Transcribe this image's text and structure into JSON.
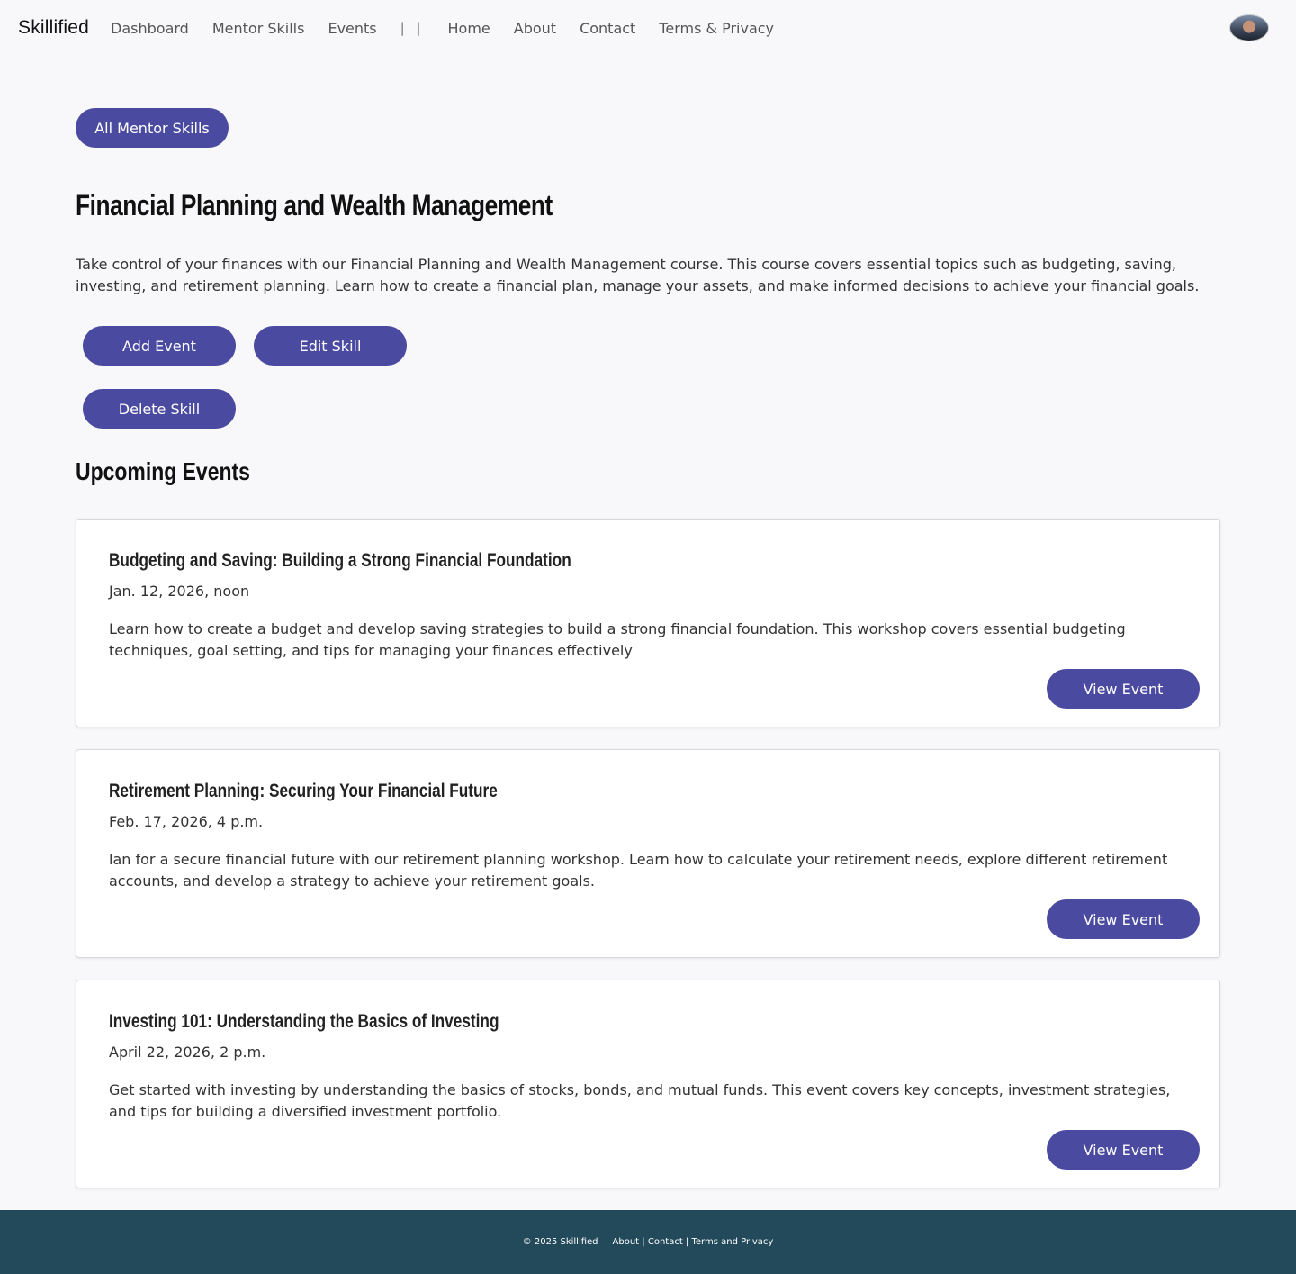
{
  "nav": {
    "brand": "Skillified",
    "links": [
      "Dashboard",
      "Mentor Skills",
      "Events"
    ],
    "separator": "| |",
    "links2": [
      "Home",
      "About",
      "Contact",
      "Terms & Privacy"
    ]
  },
  "back_button": "All Mentor Skills",
  "skill": {
    "title": "Financial Planning and Wealth Management",
    "description": "Take control of your finances with our Financial Planning and Wealth Management course. This course covers essential topics such as budgeting, saving, investing, and retirement planning. Learn how to create a financial plan, manage your assets, and make informed decisions to achieve your financial goals."
  },
  "actions": {
    "add_event": "Add Event",
    "edit_skill": "Edit Skill",
    "delete_skill": "Delete Skill"
  },
  "events_heading": "Upcoming Events",
  "events": [
    {
      "title": "Budgeting and Saving: Building a Strong Financial Foundation",
      "date": "Jan. 12, 2026, noon",
      "description": "Learn how to create a budget and develop saving strategies to build a strong financial foundation. This workshop covers essential budgeting techniques, goal setting, and tips for managing your finances effectively",
      "button": "View Event"
    },
    {
      "title": "Retirement Planning: Securing Your Financial Future",
      "date": "Feb. 17, 2026, 4 p.m.",
      "description": "lan for a secure financial future with our retirement planning workshop. Learn how to calculate your retirement needs, explore different retirement accounts, and develop a strategy to achieve your retirement goals.",
      "button": "View Event"
    },
    {
      "title": "Investing 101: Understanding the Basics of Investing",
      "date": "April 22, 2026, 2 p.m.",
      "description": "Get started with investing by understanding the basics of stocks, bonds, and mutual funds. This event covers key concepts, investment strategies, and tips for building a diversified investment portfolio.",
      "button": "View Event"
    }
  ],
  "footer": {
    "copyright": "© 2025 Skillified",
    "about": "About",
    "contact": "Contact",
    "terms": "Terms and Privacy",
    "divider": " | "
  },
  "colors": {
    "accent": "#4b4aa1",
    "footer_bg": "#234a5b",
    "page_bg": "#f8f8fa"
  }
}
